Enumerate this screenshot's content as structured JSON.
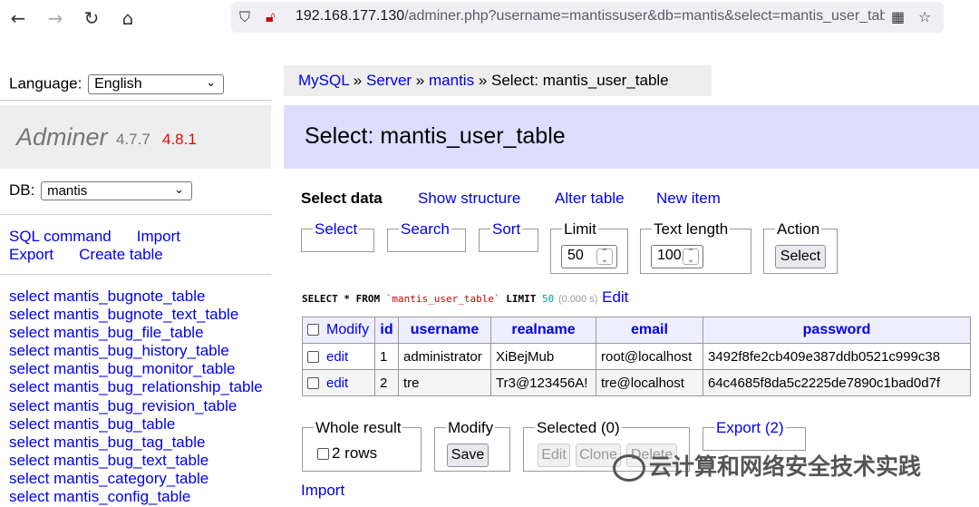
{
  "browser": {
    "url_host": "192.168.177.130",
    "url_rest": "/adminer.php?username=mantissuser&db=mantis&select=mantis_user_table"
  },
  "sidebar": {
    "language_label": "Language:",
    "language_value": "English",
    "adminer_name": "Adminer",
    "adminer_version": "4.7.7",
    "adminer_new_version": "4.8.1",
    "db_label": "DB:",
    "db_value": "mantis",
    "links": {
      "sql_command": "SQL command",
      "import": "Import",
      "export": "Export",
      "create_table": "Create table"
    },
    "tables": [
      "select mantis_bugnote_table",
      "select mantis_bugnote_text_table",
      "select mantis_bug_file_table",
      "select mantis_bug_history_table",
      "select mantis_bug_monitor_table",
      "select mantis_bug_relationship_table",
      "select mantis_bug_revision_table",
      "select mantis_bug_table",
      "select mantis_bug_tag_table",
      "select mantis_bug_text_table",
      "select mantis_category_table",
      "select mantis_config_table"
    ]
  },
  "breadcrumb": {
    "mysql": "MySQL",
    "server": "Server",
    "db": "mantis",
    "current": "Select: mantis_user_table",
    "sep": "»"
  },
  "main": {
    "title": "Select: mantis_user_table",
    "nav": {
      "select_data": "Select data",
      "show_structure": "Show structure",
      "alter_table": "Alter table",
      "new_item": "New item"
    },
    "form": {
      "select_legend": "Select",
      "search_legend": "Search",
      "sort_legend": "Sort",
      "limit_legend": "Limit",
      "limit_value": "50",
      "text_length_legend": "Text length",
      "text_length_value": "100",
      "action_legend": "Action",
      "action_button": "Select"
    },
    "sql": {
      "select_kw": "SELECT",
      "star": "*",
      "from_kw": "FROM",
      "table": "`mantis_user_table`",
      "limit_kw": "LIMIT",
      "limit_num": "50",
      "time": "(0.000 s)",
      "edit": "Edit"
    },
    "table": {
      "headers": [
        "Modify",
        "id",
        "username",
        "realname",
        "email",
        "password"
      ],
      "rows": [
        {
          "edit": "edit",
          "id": "1",
          "username": "administrator",
          "realname": "XiBejMub",
          "email": "root@localhost",
          "password": "3492f8fe2cb409e387ddb0521c999c38"
        },
        {
          "edit": "edit",
          "id": "2",
          "username": "tre",
          "realname": "Tr3@123456A!",
          "email": "tre@localhost",
          "password": "64c4685f8da5c2225de7890c1bad0d7f"
        }
      ]
    },
    "bottom": {
      "whole_result": "Whole result",
      "rows": "2 rows",
      "modify": "Modify",
      "save": "Save",
      "selected": "Selected (0)",
      "edit": "Edit",
      "clone": "Clone",
      "delete": "Delete",
      "export": "Export (2)",
      "import": "Import"
    }
  },
  "watermark": "云计算和网络安全技术实践"
}
